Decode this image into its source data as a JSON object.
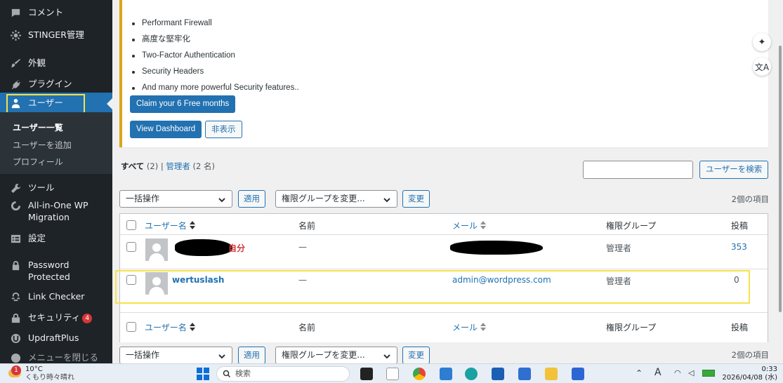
{
  "sidebar": {
    "items": [
      {
        "label": "コメント",
        "icon": "comment-icon"
      },
      {
        "label": "STINGER管理",
        "icon": "gear-icon"
      },
      {
        "label": "外観",
        "icon": "appearance-icon"
      },
      {
        "label": "プラグイン",
        "icon": "plugin-icon"
      },
      {
        "label": "ユーザー",
        "icon": "user-icon"
      },
      {
        "label": "ツール",
        "icon": "wrench-icon"
      },
      {
        "label": "All-in-One WP Migration",
        "icon": "migration-icon"
      },
      {
        "label": "設定",
        "icon": "settings-icon"
      },
      {
        "label": "Password Protected",
        "icon": "lock-icon"
      },
      {
        "label": "Link Checker",
        "icon": "link-checker-icon"
      },
      {
        "label": "セキュリティ",
        "icon": "security-icon",
        "badge": "4"
      },
      {
        "label": "UpdraftPlus",
        "icon": "updraft-icon"
      },
      {
        "label": "メニューを閉じる",
        "icon": "collapse-icon"
      }
    ],
    "submenu": [
      "ユーザー一覧",
      "ユーザーを追加",
      "プロフィール"
    ]
  },
  "notice": {
    "features": [
      "Performant Firewall",
      "高度な堅牢化",
      "Two-Factor Authentication",
      "Security Headers",
      "And many more powerful Security features.."
    ],
    "claim_button": "Claim your 6 Free months",
    "dashboard_button": "View Dashboard",
    "hide_button": "非表示"
  },
  "filters": {
    "all_label": "すべて",
    "all_count": "(2)",
    "separator": "|",
    "admin_label": "管理者",
    "admin_count": "(2 名)",
    "search_button": "ユーザーを検索",
    "search_value": ""
  },
  "bulk": {
    "select": "一括操作",
    "apply": "適用",
    "role_select": "権限グループを変更...",
    "change": "変更",
    "item_count": "2個の項目"
  },
  "table": {
    "headers": {
      "username": "ユーザー名",
      "name": "名前",
      "email": "メール",
      "role": "権限グループ",
      "posts": "投稿"
    },
    "rows": [
      {
        "username": "",
        "self_label": "自分",
        "name": "—",
        "email": "",
        "role": "管理者",
        "posts": "353"
      },
      {
        "username": "wertuslash",
        "name": "—",
        "email": "admin@wordpress.com",
        "role": "管理者",
        "posts": "0"
      }
    ]
  },
  "taskbar": {
    "weather_temp": "10°C",
    "weather_desc": "くもり時々晴れ",
    "weather_badge": "1",
    "search_placeholder": "検索",
    "ime": "A",
    "time": "0:33",
    "date": "2026/04/08 (水)"
  },
  "colors": {
    "accent": "#2271b1",
    "highlight": "#f4e24a",
    "notice_border": "#dba617",
    "sidebar_bg": "#1d2327"
  }
}
